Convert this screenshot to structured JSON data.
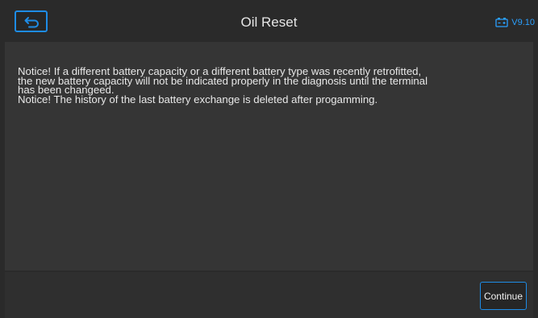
{
  "header": {
    "title": "Oil Reset",
    "version": "V9.10",
    "back_icon": "back-arrow-icon",
    "battery_icon": "battery-icon"
  },
  "message": {
    "lines": [
      "Notice! If a different battery capacity or a  different battery type was recently retrofitted,",
      "the new battery capacity will not be indicated properly in the diagnosis until the terminal",
      "has been changeed.",
      "Notice! The history of the last battery exchange is deleted after progamming."
    ]
  },
  "footer": {
    "continue_label": "Continue"
  },
  "colors": {
    "accent": "#1e8ce6",
    "version_text": "#2aa0ff",
    "background": "#353535"
  }
}
